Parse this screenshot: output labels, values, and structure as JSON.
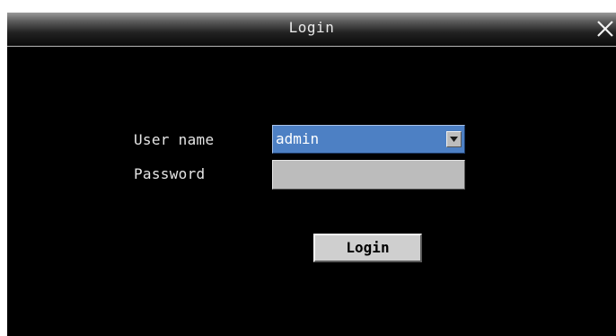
{
  "window": {
    "title": "Login"
  },
  "form": {
    "username_label": "User name",
    "username_value": "admin",
    "password_label": "Password",
    "password_value": "",
    "login_button": "Login"
  },
  "icons": {
    "close": "close-icon",
    "dropdown": "chevron-down-icon"
  },
  "colors": {
    "background": "#000000",
    "selected_field": "#4d80c4",
    "input_field": "#bcbcbc",
    "button": "#cfcfcf",
    "label_text": "#e6e6e6"
  }
}
